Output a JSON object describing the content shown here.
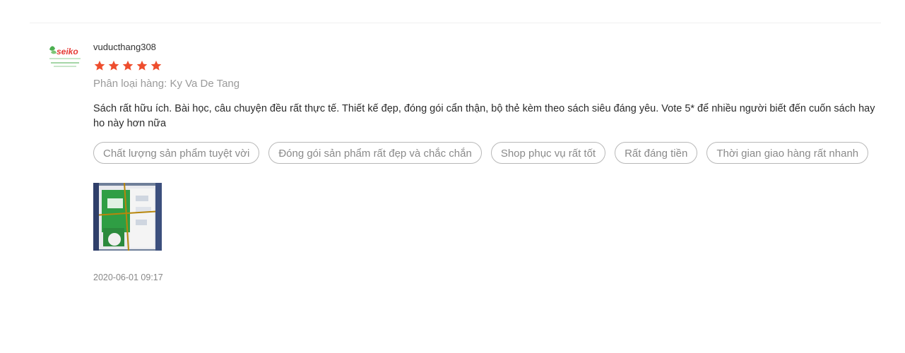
{
  "review": {
    "avatar_brand": "seiko",
    "username": "vuducthang308",
    "rating": 5,
    "rating_max": 5,
    "star_color": "#ee4d2d",
    "variation_label": "Phân loại hàng:",
    "variation_value": "Ky Va De Tang",
    "comment": "Sách rất hữu ích. Bài học, câu chuyện đều rất thực tế. Thiết kế đẹp, đóng gói cẩn thận, bộ thẻ kèm theo sách siêu đáng yêu. Vote 5* để nhiều người biết đến cuốn sách hay ho này hơn nữa",
    "tags": [
      "Chất lượng sản phẩm tuyệt vời",
      "Đóng gói sản phẩm rất đẹp và chắc chắn",
      "Shop phục vụ rất tốt",
      "Rất đáng tiền",
      "Thời gian giao hàng rất nhanh"
    ],
    "timestamp": "2020-06-01 09:17"
  }
}
